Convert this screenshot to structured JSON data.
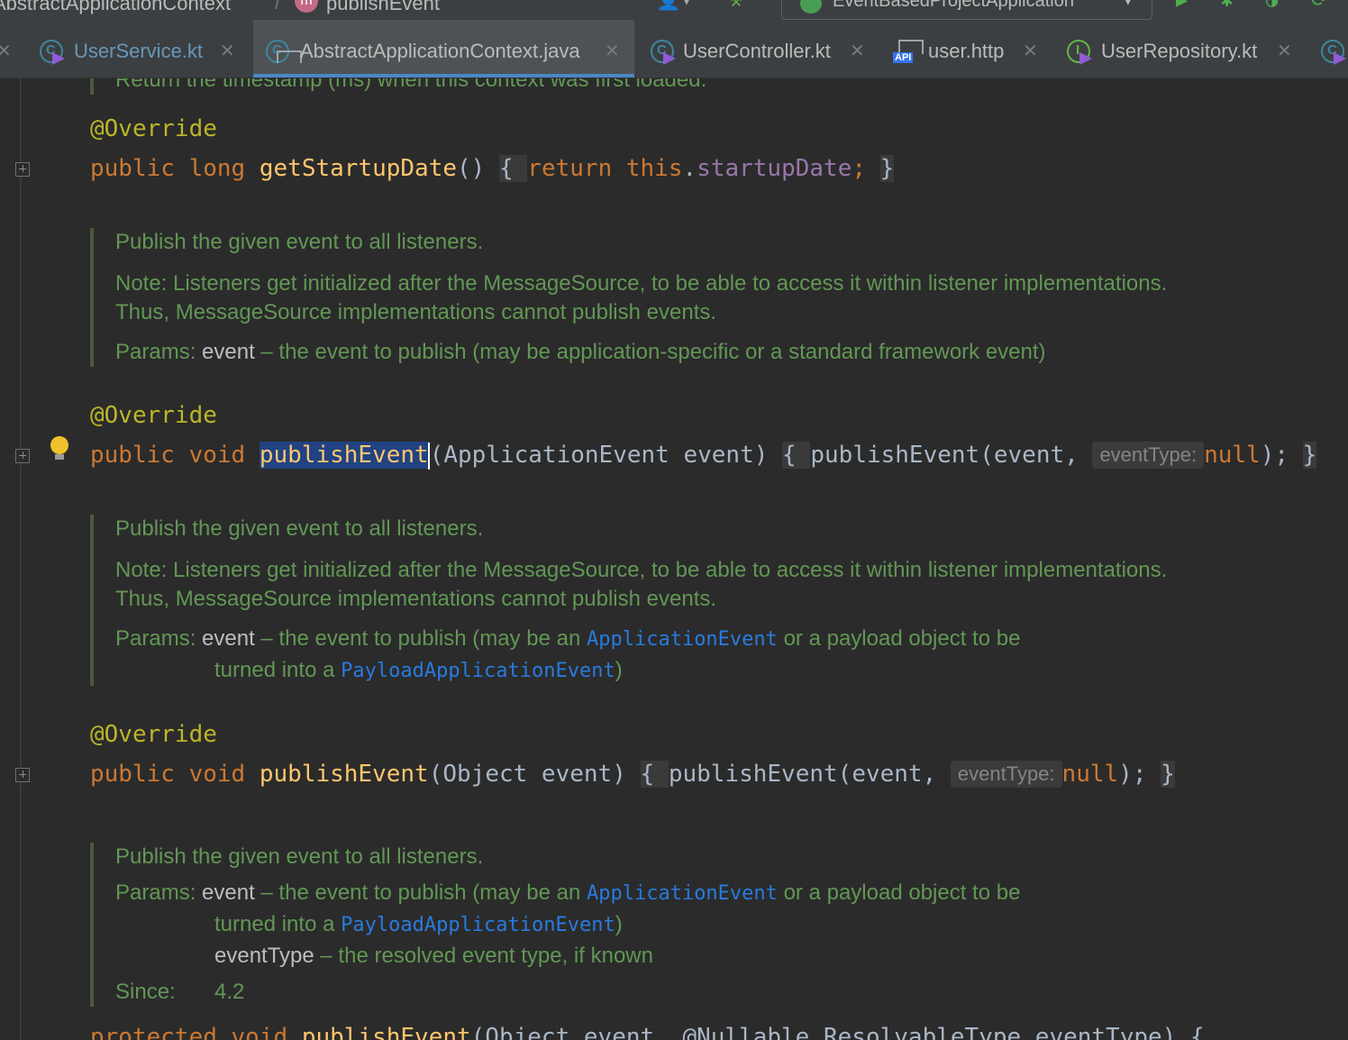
{
  "navbar": {
    "breadcrumb_class": "AbstractApplicationContext",
    "breadcrumb_method": "publishEvent",
    "method_icon_letter": "m",
    "run_configuration": "EventBasedProjectApplication"
  },
  "tabs": [
    {
      "label": "UserService.kt",
      "color": "#6897bb"
    },
    {
      "label": "AbstractApplicationContext.java",
      "color": "#bbbbbb"
    },
    {
      "label": "UserController.kt",
      "color": "#bbbbbb"
    },
    {
      "label": "user.http",
      "color": "#bbbbbb"
    },
    {
      "label": "UserRepository.kt",
      "color": "#bbbbbb"
    }
  ],
  "tab_icons": {
    "class_letter": "C",
    "api": "API",
    "interface_letter": "I"
  },
  "editor": {
    "top_doc_fragment": "Return the timestamp (ms) when this context was first loaded.",
    "block1": {
      "annotation": "@Override",
      "kw_public": "public",
      "kw_type": "long",
      "method": "getStartupDate",
      "parens": "()",
      "open_brace": "{",
      "kw_return": "return",
      "kw_this": "this",
      "dot": ".",
      "field": "startupDate",
      "semicolon": ";",
      "close_brace": "}"
    },
    "doc2": {
      "summary": "Publish the given event to all listeners.",
      "note": "Note: Listeners get initialized after the MessageSource, to be able to access it within listener implementations. Thus, MessageSource implementations cannot publish events.",
      "params_label": "Params:",
      "param_name": "event",
      "param_desc": " – the event to publish (may be application-specific or a standard framework event)"
    },
    "block2": {
      "annotation": "@Override",
      "kw_public": "public",
      "kw_void": "void",
      "method": "publishEvent",
      "signature": "(ApplicationEvent event)",
      "open_brace": "{",
      "call": "publishEvent(event,",
      "hint": "eventType:",
      "kw_null": "null",
      "close_paren": ");",
      "close_brace": "}"
    },
    "doc3": {
      "summary": "Publish the given event to all listeners.",
      "note": "Note: Listeners get initialized after the MessageSource, to be able to access it within listener implementations. Thus, MessageSource implementations cannot publish events.",
      "params_label": "Params:",
      "param_name": "event",
      "param_desc_1": " – the event to publish (may be an ",
      "link_1": "ApplicationEvent",
      "param_desc_2": " or a payload object to be",
      "param_desc_3": "turned into a ",
      "link_2": "PayloadApplicationEvent",
      "param_desc_4": ")"
    },
    "block3": {
      "annotation": "@Override",
      "kw_public": "public",
      "kw_void": "void",
      "method": "publishEvent",
      "signature": "(Object event)",
      "open_brace": "{",
      "call": "publishEvent(event,",
      "hint": "eventType:",
      "kw_null": "null",
      "close_paren": ");",
      "close_brace": "}"
    },
    "doc4": {
      "summary": "Publish the given event to all listeners.",
      "params_label": "Params:",
      "param_name": "event",
      "param_desc_1": " – the event to publish (may be an ",
      "link_1": "ApplicationEvent",
      "param_desc_2": " or a payload object to be",
      "param_desc_3": "turned into a ",
      "link_2": "PayloadApplicationEvent",
      "param_desc_4": ")",
      "param2_name": "eventType",
      "param2_desc": " – the resolved event type, if known",
      "since_label": "Since:",
      "since_value": "4.2"
    },
    "bottom_fragment_kw": "protected void ",
    "bottom_fragment_method": "publishEvent",
    "bottom_fragment_rest": "(Object event, @Nullable ResolvableType eventType) {"
  },
  "colors": {
    "background": "#2b2b2b",
    "keyword": "#cc7832",
    "annotation": "#bbb529",
    "method": "#ffc66d",
    "field": "#9876aa",
    "doc": "#629755",
    "link": "#287bde",
    "selection": "#214283"
  }
}
